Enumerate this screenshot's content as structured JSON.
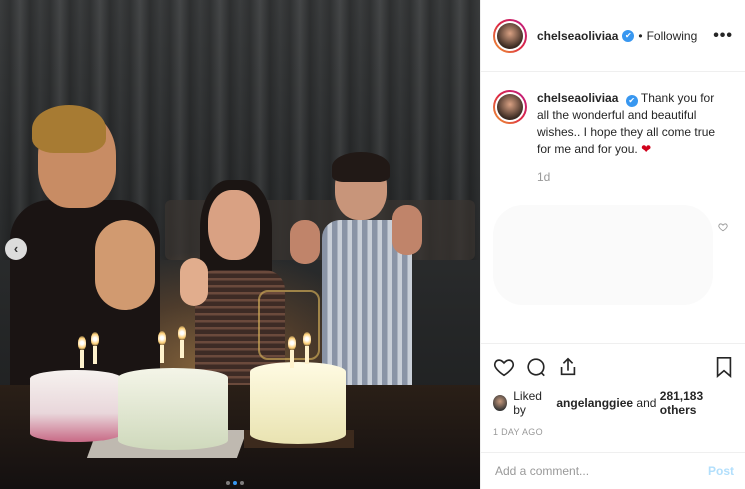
{
  "post": {
    "username": "chelseaoliviaa",
    "verified_glyph": "✔",
    "separator": "•",
    "follow_status": "Following",
    "more_label": "•••",
    "carousel_prev_glyph": "‹",
    "carousel_dots": 3,
    "carousel_active_index": 1
  },
  "caption": {
    "username": "chelseaoliviaa",
    "text": "Thank you for all the wonderful and beautiful wishes.. I hope they all come true for me and for you.",
    "heart": "❤",
    "time": "1d"
  },
  "comment": {
    "like_icon": "heart-outline-icon"
  },
  "actions": {
    "like_icon": "heart-outline-icon",
    "comment_icon": "comment-bubble-icon",
    "share_icon": "share-icon",
    "save_icon": "bookmark-icon"
  },
  "likes": {
    "prefix": "Liked by ",
    "user": "angelanggiee",
    "suffix": " and ",
    "count": "281,183 others"
  },
  "post_date": "1 DAY AGO",
  "comment_box": {
    "placeholder": "Add a comment...",
    "post_label": "Post"
  },
  "colors": {
    "accent": "#3897f0",
    "post_disabled": "#b2dffc",
    "heart": "#d0021b"
  }
}
